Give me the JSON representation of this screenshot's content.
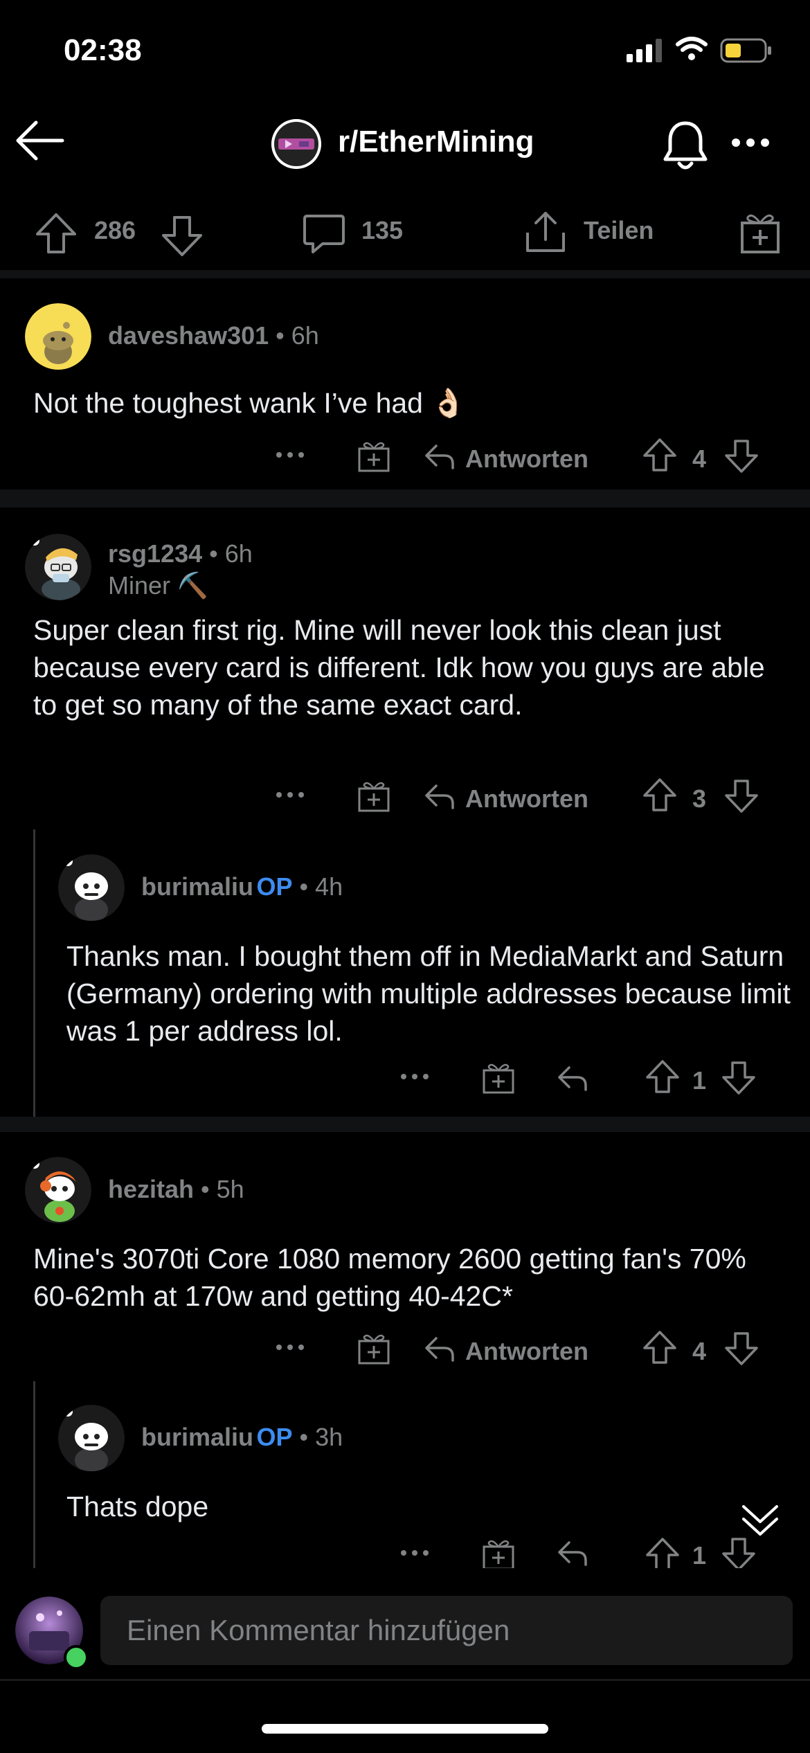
{
  "status": {
    "time": "02:38"
  },
  "nav": {
    "subreddit": "r/EtherMining"
  },
  "post_actions": {
    "upvotes": "286",
    "comments": "135",
    "share_label": "Teilen"
  },
  "comments": [
    {
      "user": "daveshaw301",
      "age": "6h",
      "text": "Not the toughest wank I’ve had 👌🏻",
      "reply_label": "Antworten",
      "votes": "4"
    },
    {
      "user": "rsg1234",
      "age": "6h",
      "flair": "Miner ⛏️",
      "text": "Super clean first rig. Mine will never look this clean just because every card is different. Idk how you guys are able to get so many of the same exact card.",
      "reply_label": "Antworten",
      "votes": "3"
    },
    {
      "user": "burimaliu",
      "op": "OP",
      "age": "4h",
      "text": "Thanks man. I bought them off in MediaMarkt and Saturn (Germany) ordering with multiple addresses because limit was 1 per address lol.",
      "votes": "1"
    },
    {
      "user": "hezitah",
      "age": "5h",
      "text": "Mine's 3070ti Core 1080 memory 2600 getting fan's 70% 60-62mh  at 170w and getting 40-42C*",
      "reply_label": "Antworten",
      "votes": "4"
    },
    {
      "user": "burimaliu",
      "op": "OP",
      "age": "3h",
      "text": "Thats dope",
      "votes": "1"
    }
  ],
  "composer": {
    "placeholder": "Einen Kommentar hinzufügen"
  },
  "colors": {
    "background": "#000000",
    "op_blue": "#3c8cf0",
    "muted": "#818384",
    "battery": "#f5d33b"
  }
}
